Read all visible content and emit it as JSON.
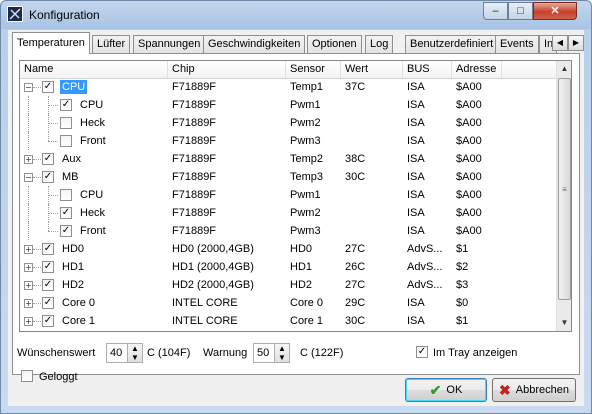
{
  "window": {
    "title": "Konfiguration"
  },
  "title_buttons": {
    "minimize": "–",
    "maximize": "□",
    "close": "✕"
  },
  "tabs": [
    {
      "label": "Temperaturen",
      "active": true
    },
    {
      "label": "Lüfter"
    },
    {
      "label": "Spannungen"
    },
    {
      "label": "Geschwindigkeiten"
    },
    {
      "label": "Optionen"
    },
    {
      "label": "Log"
    },
    {
      "label": "Benutzerdefiniert"
    },
    {
      "label": "Events"
    },
    {
      "label": "In"
    }
  ],
  "tab_scroll": {
    "left": "◀",
    "right": "▶"
  },
  "columns": [
    "Name",
    "Chip",
    "Sensor",
    "Wert",
    "BUS",
    "Adresse"
  ],
  "rows": [
    {
      "level": 0,
      "expander": "−",
      "checked": true,
      "name": "CPU",
      "chip": "F71889F",
      "sensor": "Temp1",
      "wert": "37C",
      "bus": "ISA",
      "adresse": "$A00",
      "selected": true
    },
    {
      "level": 1,
      "checked": true,
      "name": "CPU",
      "chip": "F71889F",
      "sensor": "Pwm1",
      "wert": "",
      "bus": "ISA",
      "adresse": "$A00"
    },
    {
      "level": 1,
      "checked": false,
      "name": "Heck",
      "chip": "F71889F",
      "sensor": "Pwm2",
      "wert": "",
      "bus": "ISA",
      "adresse": "$A00"
    },
    {
      "level": 1,
      "checked": false,
      "name": "Front",
      "chip": "F71889F",
      "sensor": "Pwm3",
      "wert": "",
      "bus": "ISA",
      "adresse": "$A00",
      "last": true
    },
    {
      "level": 0,
      "expander": "+",
      "checked": true,
      "name": "Aux",
      "chip": "F71889F",
      "sensor": "Temp2",
      "wert": "38C",
      "bus": "ISA",
      "adresse": "$A00"
    },
    {
      "level": 0,
      "expander": "−",
      "checked": true,
      "name": "MB",
      "chip": "F71889F",
      "sensor": "Temp3",
      "wert": "30C",
      "bus": "ISA",
      "adresse": "$A00"
    },
    {
      "level": 1,
      "checked": false,
      "name": "CPU",
      "chip": "F71889F",
      "sensor": "Pwm1",
      "wert": "",
      "bus": "ISA",
      "adresse": "$A00"
    },
    {
      "level": 1,
      "checked": true,
      "name": "Heck",
      "chip": "F71889F",
      "sensor": "Pwm2",
      "wert": "",
      "bus": "ISA",
      "adresse": "$A00"
    },
    {
      "level": 1,
      "checked": true,
      "name": "Front",
      "chip": "F71889F",
      "sensor": "Pwm3",
      "wert": "",
      "bus": "ISA",
      "adresse": "$A00",
      "last": true
    },
    {
      "level": 0,
      "expander": "+",
      "checked": true,
      "name": "HD0",
      "chip": "HD0 (2000,4GB)",
      "sensor": "HD0",
      "wert": "27C",
      "bus": "AdvS...",
      "adresse": "$1"
    },
    {
      "level": 0,
      "expander": "+",
      "checked": true,
      "name": "HD1",
      "chip": "HD1 (2000,4GB)",
      "sensor": "HD1",
      "wert": "26C",
      "bus": "AdvS...",
      "adresse": "$2"
    },
    {
      "level": 0,
      "expander": "+",
      "checked": true,
      "name": "HD2",
      "chip": "HD2 (2000,4GB)",
      "sensor": "HD2",
      "wert": "27C",
      "bus": "AdvS...",
      "adresse": "$3"
    },
    {
      "level": 0,
      "expander": "+",
      "checked": true,
      "name": "Core 0",
      "chip": "INTEL CORE",
      "sensor": "Core 0",
      "wert": "29C",
      "bus": "ISA",
      "adresse": "$0"
    },
    {
      "level": 0,
      "expander": "+",
      "checked": true,
      "name": "Core 1",
      "chip": "INTEL CORE",
      "sensor": "Core 1",
      "wert": "30C",
      "bus": "ISA",
      "adresse": "$1"
    }
  ],
  "scrollbar": {
    "up": "▲",
    "down": "▼",
    "grip": "≡"
  },
  "settings": {
    "wunschwert_label": "Wünschenswert",
    "wunschwert_value": "40",
    "wunschwert_unit": "C (104F)",
    "warnung_label": "Warnung",
    "warnung_value": "50",
    "warnung_unit": "C (122F)",
    "tray_label": "Im Tray anzeigen",
    "tray_checked": true,
    "geloggt_label": "Geloggt",
    "geloggt_checked": false,
    "spin_up": "▲",
    "spin_down": "▼"
  },
  "buttons": {
    "ok": "OK",
    "ok_icon": "✔",
    "cancel": "Abbrechen",
    "cancel_icon": "✖"
  },
  "colors": {
    "selection": "#3399ff",
    "ok_icon": "#2f9e23",
    "cancel_icon": "#c52020"
  }
}
